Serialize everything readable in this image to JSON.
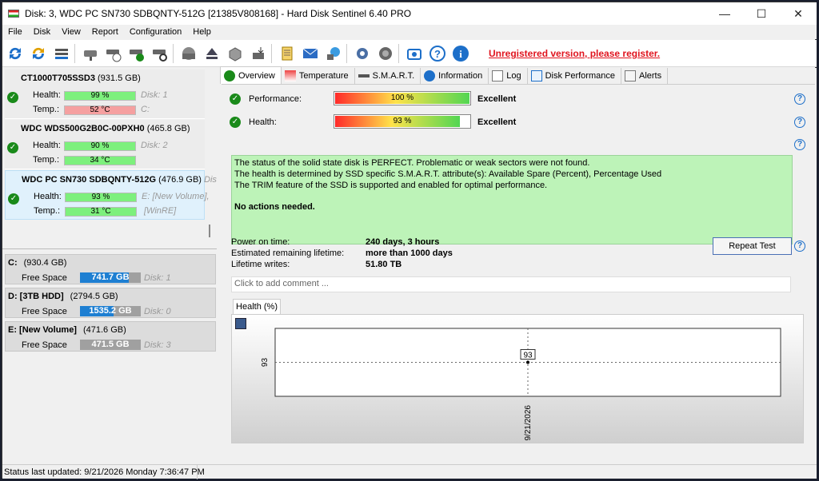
{
  "window": {
    "title": "Disk: 3, WDC PC SN730 SDBQNTY-512G [21385V808168]  -  Hard Disk Sentinel 6.40 PRO"
  },
  "menu": [
    "File",
    "Disk",
    "View",
    "Report",
    "Configuration",
    "Help"
  ],
  "unregistered": "Unregistered version, please register.",
  "disks": [
    {
      "name": "CT1000T705SSD3",
      "size": "(931.5 GB)",
      "health_label": "Health:",
      "health": "99 %",
      "health_pct": 99,
      "temp_label": "Temp.:",
      "temp": "52 °C",
      "temp_hot": true,
      "aux1": "Disk: 1",
      "aux2": "C:"
    },
    {
      "name": "WDC WDS500G2B0C-00PXH0",
      "size": "(465.8 GB)",
      "health_label": "Health:",
      "health": "90 %",
      "health_pct": 90,
      "temp_label": "Temp.:",
      "temp": "34 °C",
      "temp_hot": false,
      "aux1": "Disk: 2",
      "aux2": ""
    },
    {
      "name": "WDC PC SN730 SDBQNTY-512G",
      "size": "(476.9 GB)",
      "health_label": "Health:",
      "health": "93 %",
      "health_pct": 93,
      "temp_label": "Temp.:",
      "temp": "31 °C",
      "temp_hot": false,
      "aux1": "E: [New Volume],",
      "aux2": "[WinRE]",
      "extra": "Dis"
    }
  ],
  "volumes": [
    {
      "name": "C:",
      "size": "(930.4 GB)",
      "label": "Free Space",
      "free": "741.7 GB",
      "free_pct": 80,
      "disk": "Disk: 1"
    },
    {
      "name": "D: [3TB HDD]",
      "size": "(2794.5 GB)",
      "label": "Free Space",
      "free": "1535.2 GB",
      "free_pct": 55,
      "disk": "Disk: 0"
    },
    {
      "name": "E: [New Volume]",
      "size": "(471.6 GB)",
      "label": "Free Space",
      "free": "471.5 GB",
      "free_pct": 100,
      "disk": "Disk: 3"
    }
  ],
  "tabs": [
    "Overview",
    "Temperature",
    "S.M.A.R.T.",
    "Information",
    "Log",
    "Disk Performance",
    "Alerts"
  ],
  "overview": {
    "performance_label": "Performance:",
    "performance": "100 %",
    "performance_pct": 100,
    "performance_rating": "Excellent",
    "health_label": "Health:",
    "health": "93 %",
    "health_pct": 93,
    "health_rating": "Excellent",
    "status_lines": [
      "The status of the solid state disk is PERFECT. Problematic or weak sectors were not found.",
      "The health is determined by SSD specific S.M.A.R.T. attribute(s):  Available Spare (Percent), Percentage Used",
      "The TRIM feature of the SSD is supported and enabled for optimal performance."
    ],
    "actions": "No actions needed.",
    "power_on_label": "Power on time:",
    "power_on": "240 days, 3 hours",
    "remaining_label": "Estimated remaining lifetime:",
    "remaining": "more than 1000 days",
    "writes_label": "Lifetime writes:",
    "writes": "51.80 TB",
    "repeat_test": "Repeat Test",
    "comment_placeholder": "Click to add comment ..."
  },
  "chart_tab": "Health (%)",
  "chart_data": {
    "type": "line",
    "x": [
      "9/21/2026"
    ],
    "values": [
      93
    ],
    "ytick": "93",
    "point_label": "93"
  },
  "status": "Status last updated: 9/21/2026 Monday 7:36:47 PM",
  "colors": {
    "health_bar": "#7df07d",
    "temp_hot": "#f5a0a0",
    "accent": "#1d6fc9",
    "status_bg": "#bdf3b8"
  }
}
